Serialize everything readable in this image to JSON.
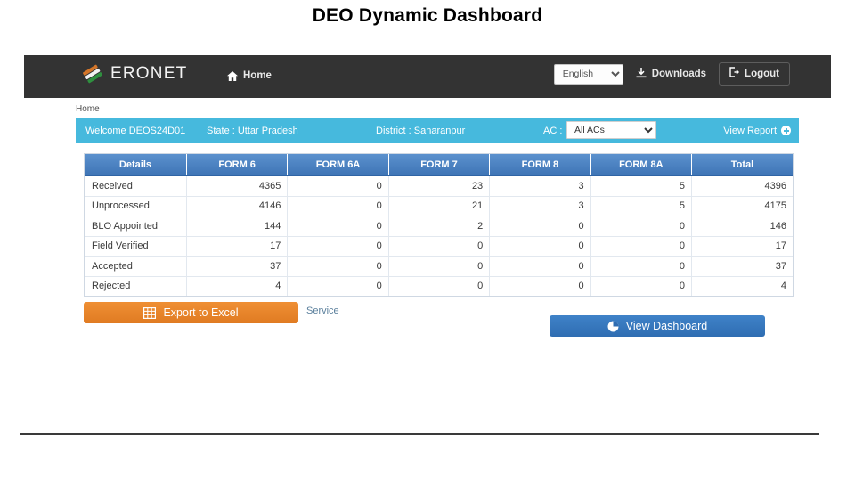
{
  "slide": {
    "title": "DEO Dynamic Dashboard"
  },
  "navbar": {
    "logo_icon": "eronet-tricolor-logo-icon",
    "brand": "ERONET",
    "home_icon": "home-icon",
    "home_label": "Home",
    "language": {
      "selected": "English",
      "options": [
        "English"
      ]
    },
    "downloads_icon": "download-icon",
    "downloads_label": "Downloads",
    "logout_icon": "logout-icon",
    "logout_label": "Logout",
    "background_color": "#333333"
  },
  "breadcrumb": {
    "label": "Home"
  },
  "infobar": {
    "welcome": "Welcome DEOS24D01",
    "state": "State : Uttar Pradesh",
    "district": "District : Saharanpur",
    "ac_label": "AC :",
    "ac_select": {
      "selected": "All ACs",
      "options": [
        "All ACs"
      ]
    },
    "view_report_label": "View Report",
    "view_report_icon": "circle-plus-icon",
    "background_color": "#46b9dd"
  },
  "table": {
    "headers": [
      "Details",
      "FORM 6",
      "FORM 6A",
      "FORM 7",
      "FORM 8",
      "FORM 8A",
      "Total"
    ],
    "header_color": "#3e74b5",
    "rows": [
      {
        "label": "Received",
        "values": [
          "4365",
          "0",
          "23",
          "3",
          "5",
          "4396"
        ]
      },
      {
        "label": "Unprocessed",
        "values": [
          "4146",
          "0",
          "21",
          "3",
          "5",
          "4175"
        ]
      },
      {
        "label": "BLO Appointed",
        "values": [
          "144",
          "0",
          "2",
          "0",
          "0",
          "146"
        ]
      },
      {
        "label": "Field Verified",
        "values": [
          "17",
          "0",
          "0",
          "0",
          "0",
          "17"
        ]
      },
      {
        "label": "Accepted",
        "values": [
          "37",
          "0",
          "0",
          "0",
          "0",
          "37"
        ]
      },
      {
        "label": "Rejected",
        "values": [
          "4",
          "0",
          "0",
          "0",
          "0",
          "4"
        ]
      }
    ]
  },
  "actions": {
    "export_icon": "table-grid-icon",
    "export_label": "Export to Excel",
    "export_color": "#e07b22",
    "service_label": "Service",
    "dashboard_icon": "pie-chart-icon",
    "dashboard_label": "View Dashboard",
    "dashboard_color": "#2f6db2"
  }
}
